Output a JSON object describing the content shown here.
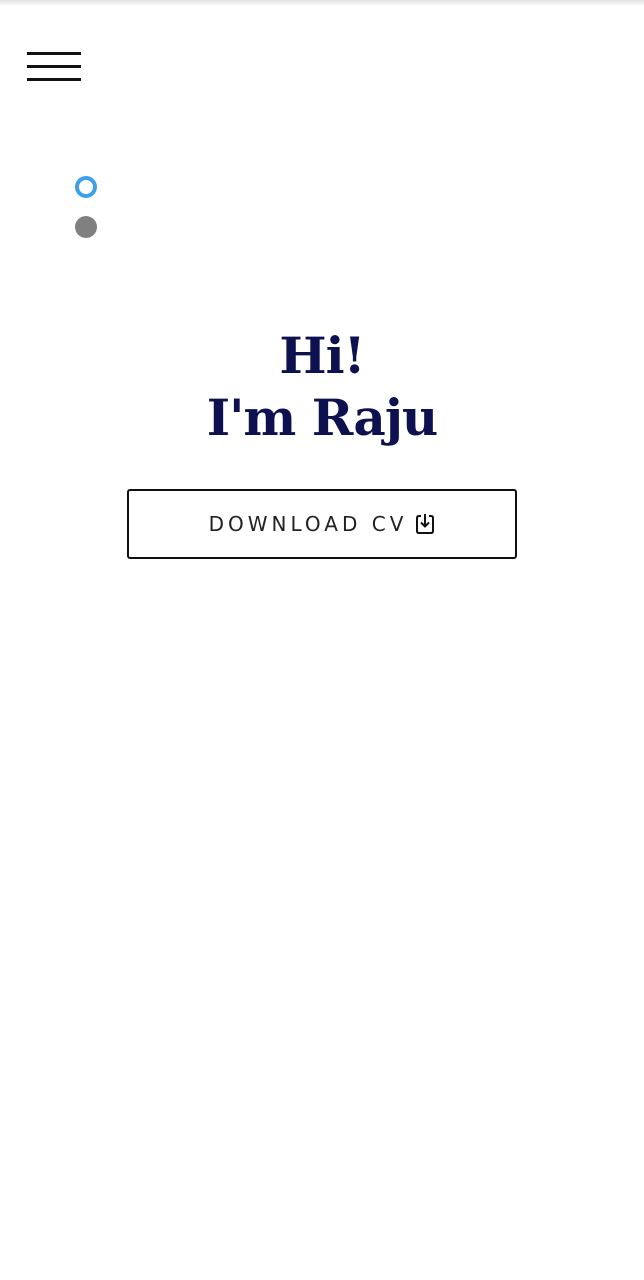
{
  "header": {
    "menu_icon": "hamburger-menu-icon"
  },
  "slider": {
    "dot_count": 2,
    "active_index": 0,
    "active_color": "#3ea0e8",
    "inactive_color": "#808080"
  },
  "hero": {
    "greeting": "Hi!",
    "intro": "I'm Raju",
    "title_color": "#0e1150"
  },
  "download_button": {
    "label": "DOWNLOAD CV",
    "icon": "download-icon"
  }
}
